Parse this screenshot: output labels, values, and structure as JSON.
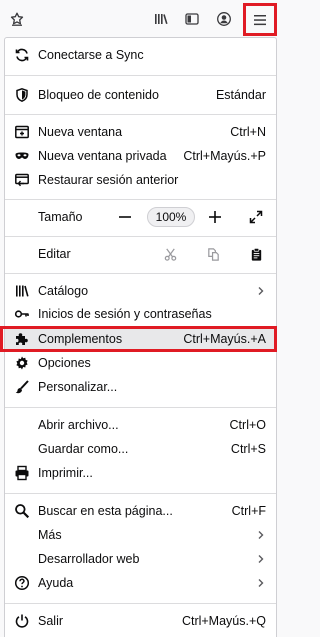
{
  "menu": {
    "sync": "Conectarse a Sync",
    "content_blocking": {
      "label": "Bloqueo de contenido",
      "value": "Estándar"
    },
    "new_window": {
      "label": "Nueva ventana",
      "shortcut": "Ctrl+N"
    },
    "new_private_window": {
      "label": "Nueva ventana privada",
      "shortcut": "Ctrl+Mayús.+P"
    },
    "restore_session": "Restaurar sesión anterior",
    "zoom": {
      "label": "Tamaño",
      "minus": "—",
      "level": "100%",
      "plus": "+"
    },
    "edit": {
      "label": "Editar"
    },
    "library": "Catálogo",
    "logins": "Inicios de sesión y contraseñas",
    "addons": {
      "label": "Complementos",
      "shortcut": "Ctrl+Mayús.+A"
    },
    "options": "Opciones",
    "customize": "Personalizar...",
    "open_file": {
      "label": "Abrir archivo...",
      "shortcut": "Ctrl+O"
    },
    "save_as": {
      "label": "Guardar como...",
      "shortcut": "Ctrl+S"
    },
    "print": "Imprimir...",
    "find": {
      "label": "Buscar en esta página...",
      "shortcut": "Ctrl+F"
    },
    "more": "Más",
    "web_developer": "Desarrollador web",
    "help": "Ayuda",
    "quit": {
      "label": "Salir",
      "shortcut": "Ctrl+Mayús.+Q"
    }
  },
  "icons": {
    "toolbar": [
      "bookmark-star-icon",
      "library-icon",
      "sidebar-icon",
      "account-icon",
      "hamburger-menu-icon"
    ]
  },
  "colors": {
    "highlight": "#e01b24"
  }
}
